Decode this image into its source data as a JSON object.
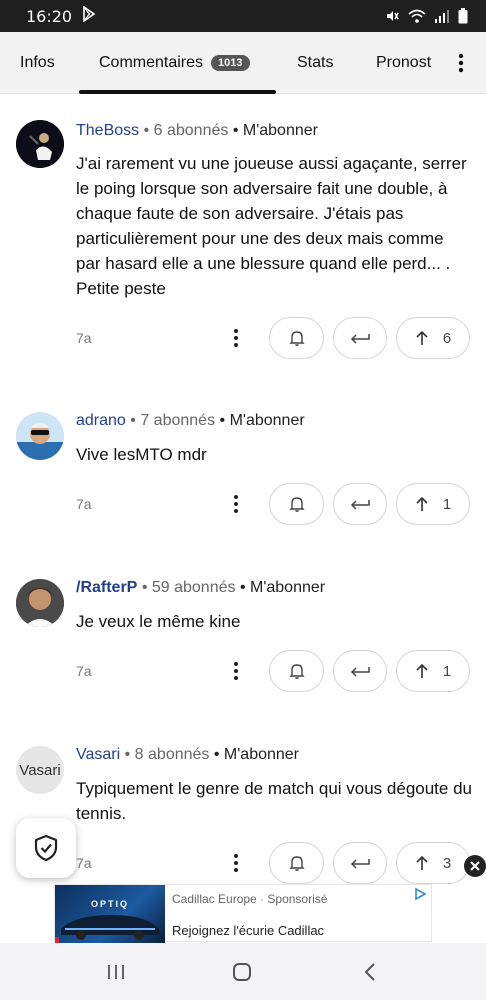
{
  "status_bar": {
    "time": "16:20"
  },
  "tabs": [
    {
      "label": "Infos"
    },
    {
      "label": "Commentaires",
      "badge": "1013"
    },
    {
      "label": "Stats"
    },
    {
      "label": "Pronost"
    }
  ],
  "comments": [
    {
      "user": "TheBoss",
      "followers": "• 6 abonnés",
      "subscribe": "• M'abonner",
      "text": "J'ai rarement vu une joueuse aussi agaçante, serrer le poing lorsque son adversaire fait une double, à chaque faute de son adversaire. J'étais pas particulièrement pour une des deux mais comme par hasard elle a une blessure quand elle perd... . Petite peste",
      "time": "7a",
      "votes": "6"
    },
    {
      "user": "adrano",
      "followers": "• 7 abonnés",
      "subscribe": "• M'abonner",
      "text": "Vive lesMTO mdr",
      "time": "7a",
      "votes": "1"
    },
    {
      "user": "/RafterP",
      "followers": "• 59 abonnés",
      "subscribe": "• M'abonner",
      "text": "Je veux le même kine",
      "time": "7a",
      "votes": "1"
    },
    {
      "user": "Vasari",
      "avatar_alt": "Vasari",
      "followers": "• 8 abonnés",
      "subscribe": "• M'abonner",
      "text": "Typiquement le genre de match qui vous dégoute du tennis.",
      "time": "7a",
      "votes": "3"
    }
  ],
  "ad": {
    "brand": "Cadillac Europe",
    "separator": "·",
    "sponsored": "Sponsorisé",
    "title": "Rejoignez l'écurie Cadillac",
    "image_text": "OPTIQ"
  },
  "colors": {
    "username": "#24408f",
    "status_bar": "#1f1f1f",
    "tab_bar": "#f2f2f2"
  }
}
